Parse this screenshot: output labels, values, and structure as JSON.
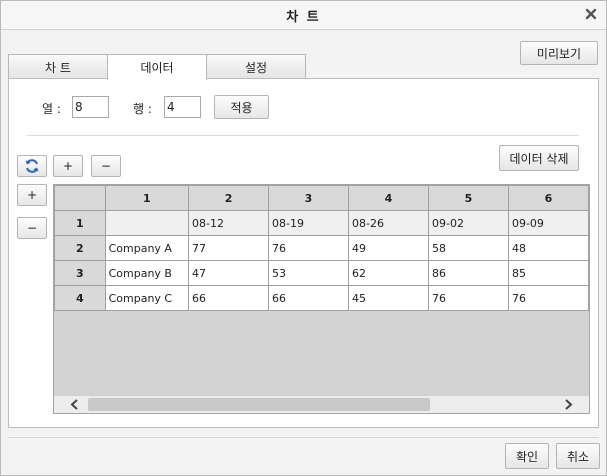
{
  "title": "차 트",
  "tabs": [
    {
      "label": "차 트"
    },
    {
      "label": "데이터"
    },
    {
      "label": "설정"
    }
  ],
  "preview_label": "미리보기",
  "columns_label": "열 :",
  "columns_value": "8",
  "rows_label": "행 :",
  "rows_value": "4",
  "apply_label": "적용",
  "add_label": "+",
  "remove_label": "−",
  "delete_data_label": "데이터 삭제",
  "grid": {
    "col_headers": [
      "1",
      "2",
      "3",
      "4",
      "5",
      "6"
    ],
    "rows": [
      {
        "num": "1",
        "cells": [
          "",
          "08-12",
          "08-19",
          "08-26",
          "09-02",
          "09-09"
        ]
      },
      {
        "num": "2",
        "cells": [
          "Company A",
          "77",
          "76",
          "49",
          "58",
          "48"
        ]
      },
      {
        "num": "3",
        "cells": [
          "Company B",
          "47",
          "53",
          "62",
          "86",
          "85"
        ]
      },
      {
        "num": "4",
        "cells": [
          "Company C",
          "66",
          "66",
          "45",
          "76",
          "76"
        ]
      }
    ]
  },
  "ok_label": "확인",
  "cancel_label": "취소",
  "colors": {
    "refresh_icon": "#2a64c6",
    "grid_header": "#d9d9d9"
  }
}
